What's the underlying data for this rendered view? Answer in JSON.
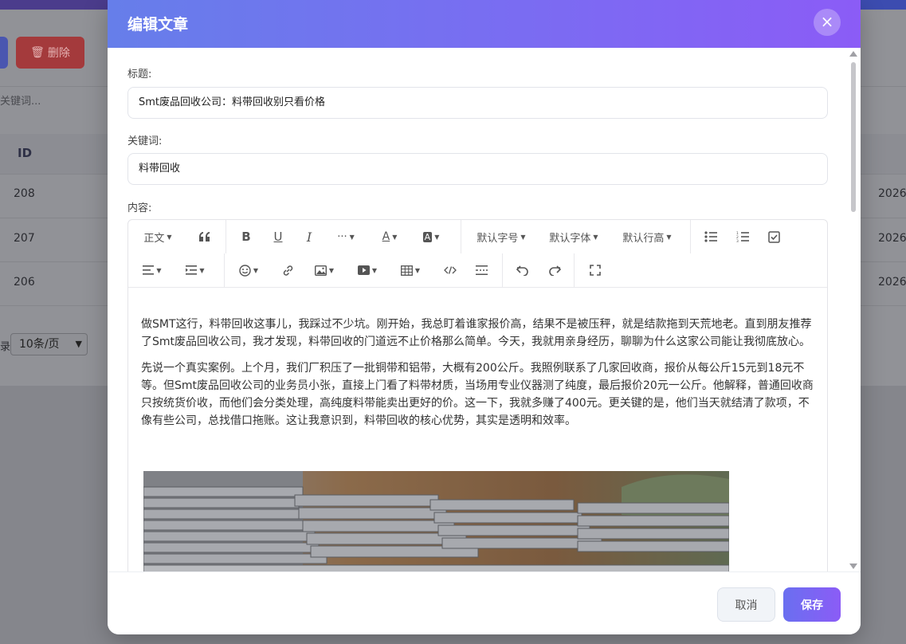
{
  "background": {
    "delete_button": "删除",
    "search_placeholder": "关键词...",
    "table_header_id": "ID",
    "rows": [
      {
        "id": "208",
        "date": "2026-"
      },
      {
        "id": "207",
        "date": "2026-"
      },
      {
        "id": "206",
        "date": "2026-"
      }
    ],
    "pager_label": "录",
    "page_size_option": "10条/页"
  },
  "modal": {
    "title": "编辑文章",
    "close_icon": "×",
    "title_label": "标题:",
    "title_value": "Smt废品回收公司：料带回收别只看价格",
    "keywords_label": "关键词:",
    "keywords_value": "料带回收",
    "content_label": "内容:",
    "toolbar": {
      "paragraph": "正文",
      "font_size": "默认字号",
      "font_family": "默认字体",
      "line_height": "默认行高",
      "more": "···"
    },
    "content_paragraphs": [
      "做SMT这行，料带回收这事儿，我踩过不少坑。刚开始，我总盯着谁家报价高，结果不是被压秤，就是结款拖到天荒地老。直到朋友推荐了Smt废品回收公司，我才发现，料带回收的门道远不止价格那么简单。今天，我就用亲身经历，聊聊为什么这家公司能让我彻底放心。",
      "先说一个真实案例。上个月，我们厂积压了一批铜带和铝带，大概有200公斤。我照例联系了几家回收商，报价从每公斤15元到18元不等。但Smt废品回收公司的业务员小张，直接上门看了料带材质，当场用专业仪器测了纯度，最后报价20元一公斤。他解释，普通回收商只按统货价收，而他们会分类处理，高纯度料带能卖出更好的价。这一下，我就多赚了400元。更关键的是，他们当天就结清了款项，不像有些公司，总找借口拖账。这让我意识到，料带回收的核心优势，其实是透明和效率。"
    ],
    "cancel_button": "取消",
    "save_button": "保存"
  }
}
